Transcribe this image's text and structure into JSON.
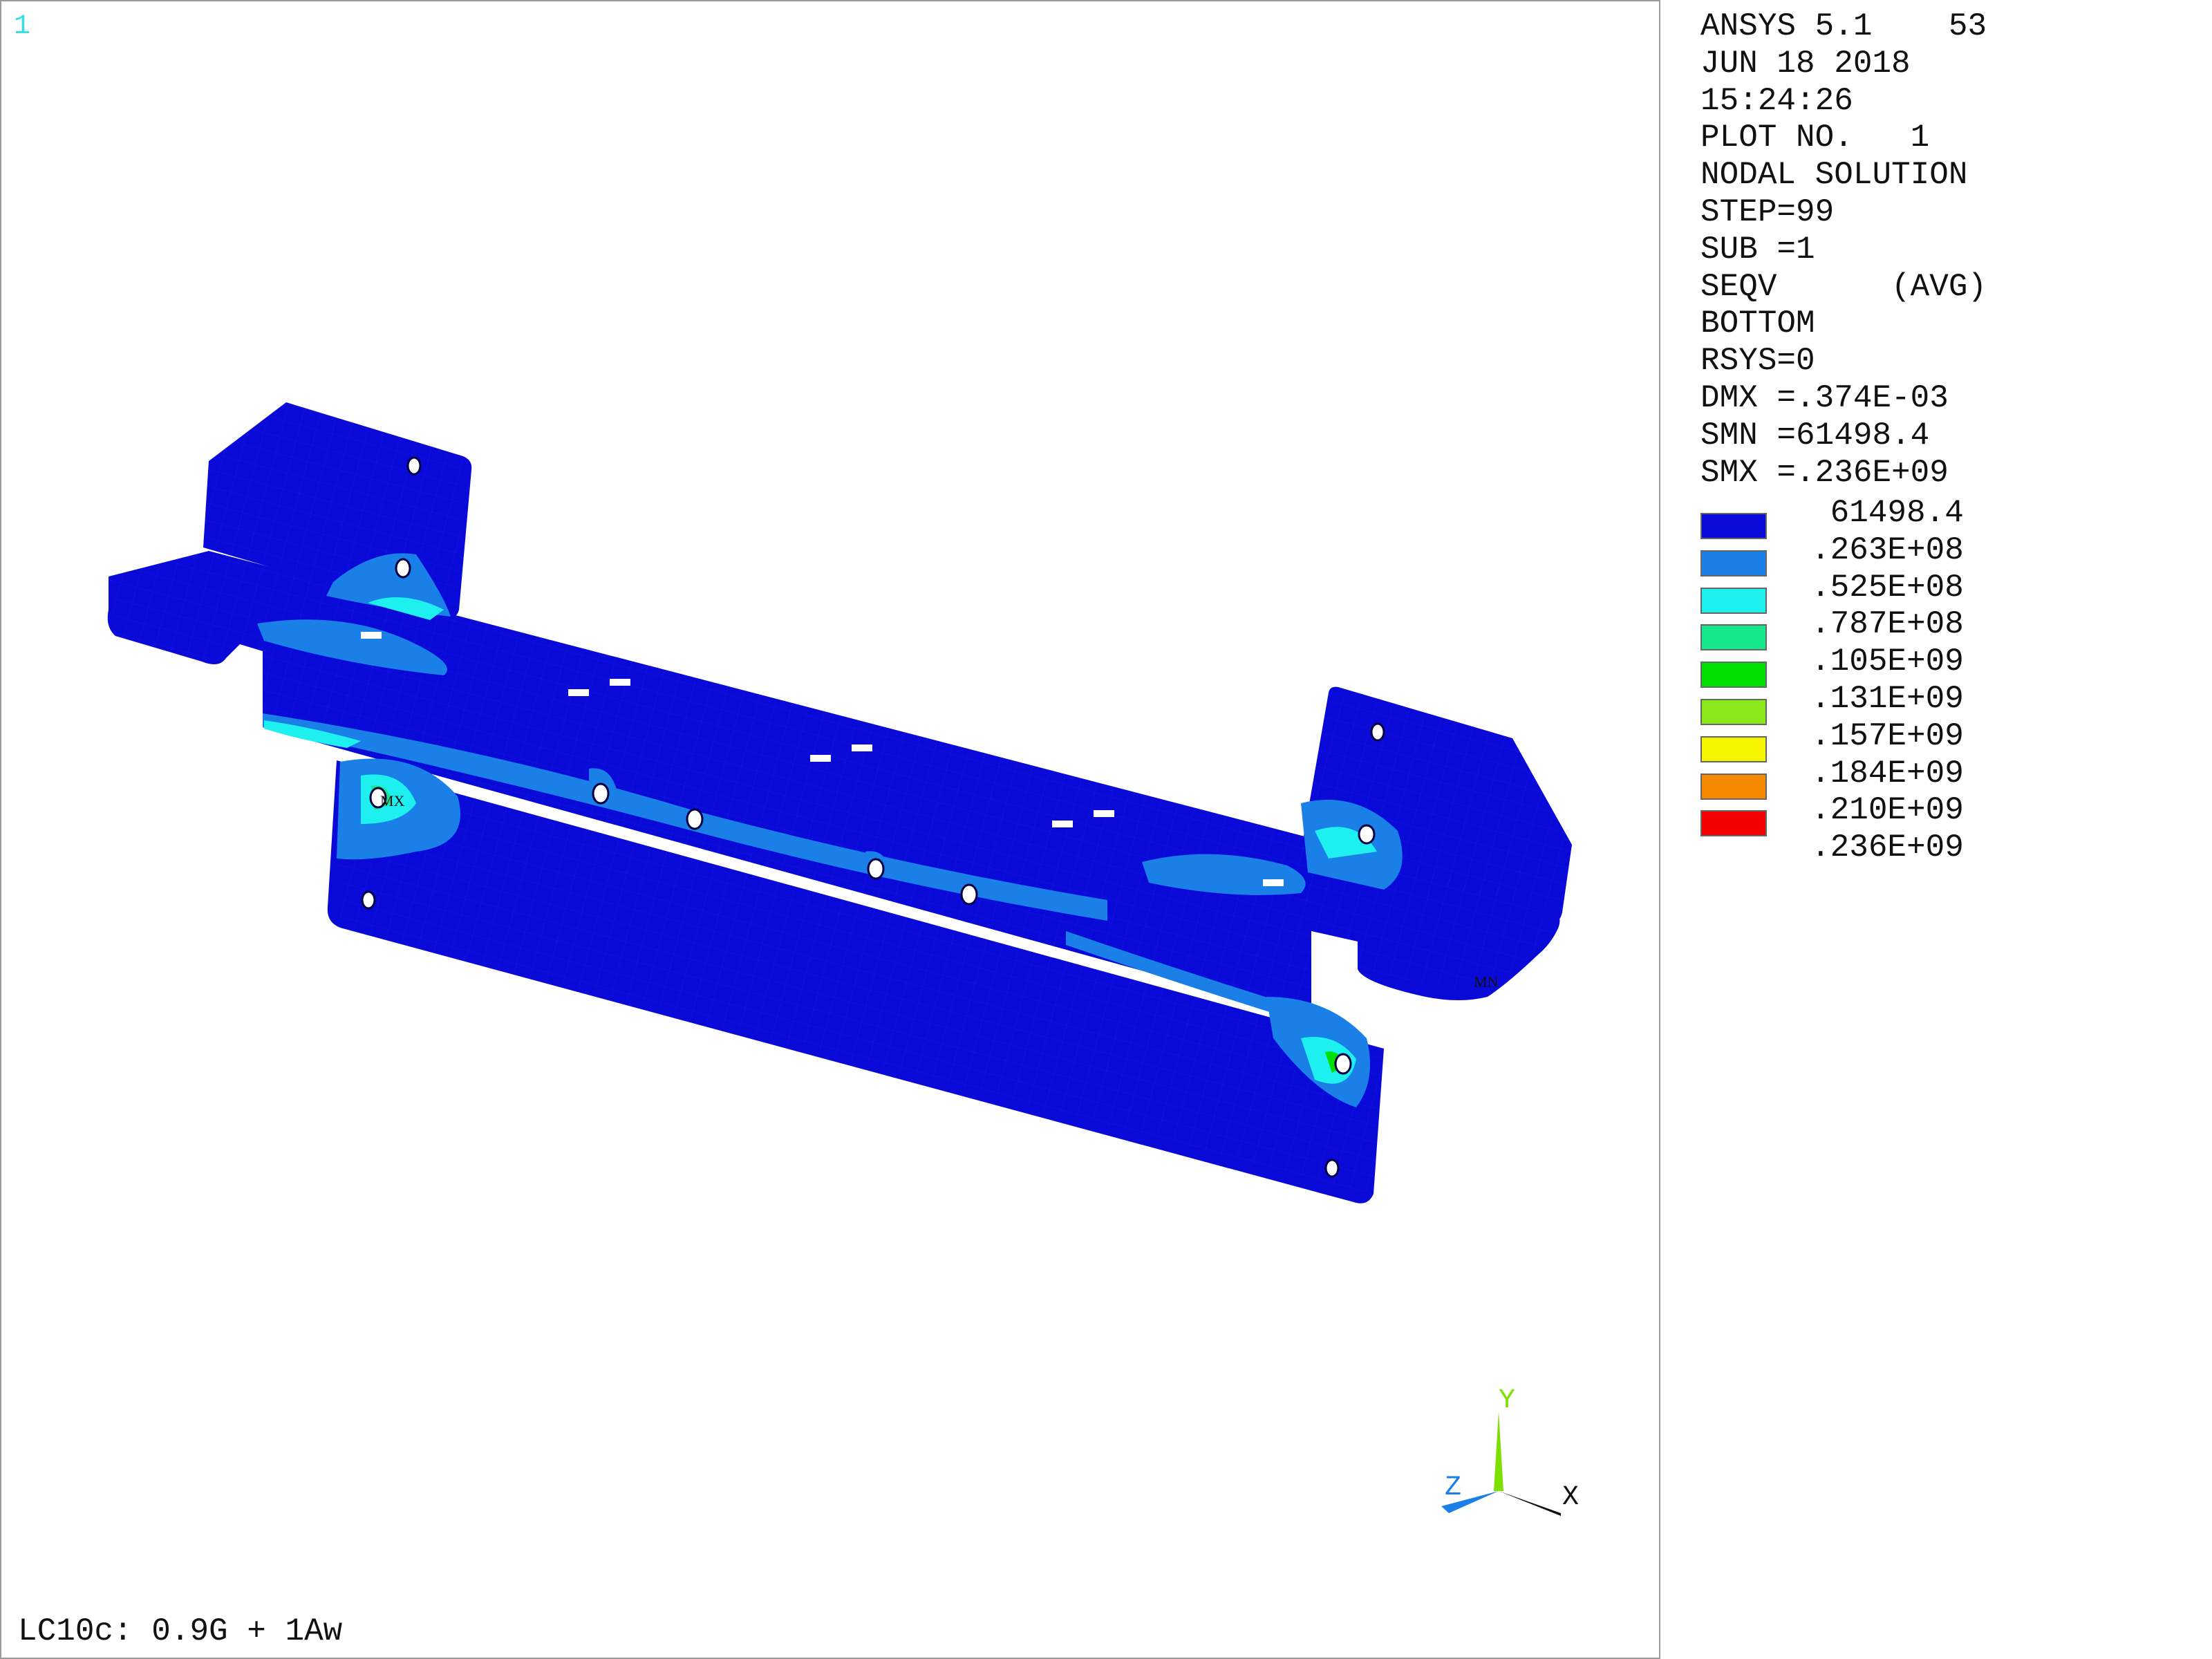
{
  "window": {
    "number": "1"
  },
  "header": {
    "lines": [
      "ANSYS 5.1    53",
      "JUN 18 2018",
      "15:24:26",
      "PLOT NO.   1",
      "NODAL SOLUTION",
      "STEP=99",
      "SUB =1",
      "SEQV      (AVG)",
      "BOTTOM",
      "RSYS=0",
      "DMX =.374E-03",
      "SMN =61498.4",
      "SMX =.236E+09"
    ]
  },
  "legend": {
    "entries": [
      {
        "value": " 61498.4",
        "color": "#0a0ad8"
      },
      {
        "value": ".263E+08",
        "color": "#1a7fe6"
      },
      {
        "value": ".525E+08",
        "color": "#1ef0f0"
      },
      {
        "value": ".787E+08",
        "color": "#15e88a"
      },
      {
        "value": ".105E+09",
        "color": "#00e000"
      },
      {
        "value": ".131E+09",
        "color": "#8ae81a"
      },
      {
        "value": ".157E+09",
        "color": "#f5f500"
      },
      {
        "value": ".184E+09",
        "color": "#f58a00"
      },
      {
        "value": ".210E+09",
        "color": "#f50000"
      }
    ],
    "last_value": ".236E+09"
  },
  "model": {
    "max_marker": "MX",
    "min_marker": "MN",
    "base_color": "#0a0ad8",
    "contour_colors": [
      "#1a7fe6",
      "#1ef0f0",
      "#15e88a",
      "#00e000",
      "#f5f500"
    ]
  },
  "triad": {
    "x_label": "X",
    "y_label": "Y",
    "z_label": "Z"
  },
  "footer": {
    "load_case": "LC10c: 0.9G + 1Aw"
  }
}
